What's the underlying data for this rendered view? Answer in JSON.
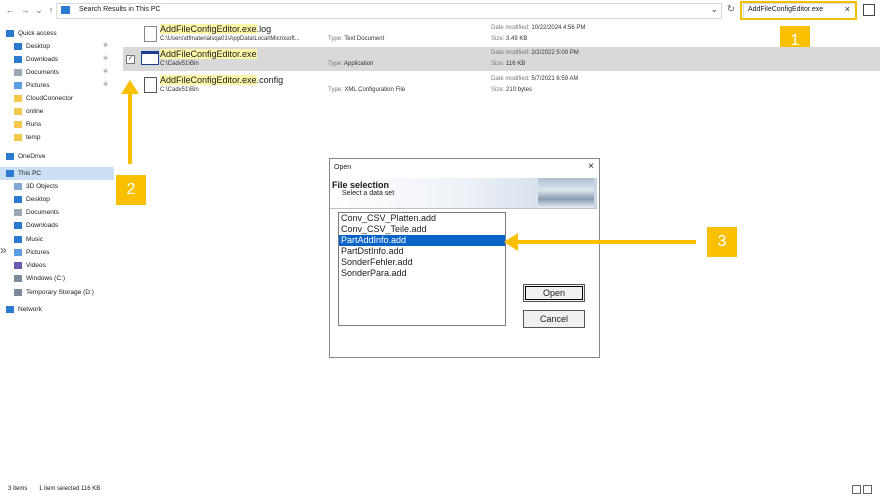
{
  "address": {
    "text": "Search Results in This PC"
  },
  "search": {
    "value": "AddFileConfigEditor.exe"
  },
  "sidebar": {
    "items": [
      {
        "label": "Quick access",
        "icon": "star-icon"
      },
      {
        "label": "Desktop",
        "icon": "desktop-icon"
      },
      {
        "label": "Downloads",
        "icon": "download-icon"
      },
      {
        "label": "Documents",
        "icon": "document-icon"
      },
      {
        "label": "Pictures",
        "icon": "picture-icon"
      },
      {
        "label": "CloudConnector",
        "icon": "folder-icon"
      },
      {
        "label": "online",
        "icon": "folder-icon"
      },
      {
        "label": "Runs",
        "icon": "folder-icon"
      },
      {
        "label": "temp",
        "icon": "folder-icon"
      },
      {
        "label": "OneDrive",
        "icon": "cloud-icon"
      },
      {
        "label": "This PC",
        "icon": "pc-icon"
      },
      {
        "label": "3D Objects",
        "icon": "cube-icon"
      },
      {
        "label": "Desktop",
        "icon": "desktop-icon"
      },
      {
        "label": "Documents",
        "icon": "document-icon"
      },
      {
        "label": "Downloads",
        "icon": "download-icon"
      },
      {
        "label": "Music",
        "icon": "music-icon"
      },
      {
        "label": "Pictures",
        "icon": "picture-icon"
      },
      {
        "label": "Videos",
        "icon": "video-icon"
      },
      {
        "label": "Windows (C:)",
        "icon": "drive-icon"
      },
      {
        "label": "Temporary Storage (D:)",
        "icon": "drive-icon"
      },
      {
        "label": "Network",
        "icon": "network-icon"
      }
    ]
  },
  "files": [
    {
      "name_hl": "AddFileConfigEditor.exe",
      "name_rest": ".log",
      "path": "C:\\Users\\dfmaterialsqa01\\AppData\\Local\\Microsoft...",
      "type_label": "Type:",
      "type": "Text Document",
      "date_label": "Date modified:",
      "date": "10/22/2024 4:56 PM",
      "size_label": "Size:",
      "size": "3.49 KB"
    },
    {
      "name_hl": "AddFileConfigEditor.exe",
      "name_rest": "",
      "path": "C:\\Cadv51\\Bin",
      "type_label": "Type:",
      "type": "Application",
      "date_label": "Date modified:",
      "date": "2/2/2022 5:00 PM",
      "size_label": "Size:",
      "size": "116 KB"
    },
    {
      "name_hl": "AddFileConfigEditor.exe",
      "name_rest": ".config",
      "path": "C:\\Cadv51\\Bin",
      "type_label": "Type:",
      "type": "XML Configuration File",
      "date_label": "Date modified:",
      "date": "5/7/2021 6:59 AM",
      "size_label": "Size:",
      "size": "210 bytes"
    }
  ],
  "dialog": {
    "title": "Open",
    "heading": "File selection",
    "subheading": "Select a data set",
    "items": [
      "Conv_CSV_Platten.add",
      "Conv_CSV_Teile.add",
      "PartAddInfo.add",
      "PartDstInfo.add",
      "SonderFehler.add",
      "SonderPara.add"
    ],
    "selected": "PartAddInfo.add",
    "open_label": "Open",
    "cancel_label": "Cancel"
  },
  "callouts": [
    "1",
    "2",
    "3"
  ],
  "status": {
    "items": "3 items",
    "selected": "1 item selected  116 KB"
  },
  "colors": {
    "callout": "#f8c000",
    "selection": "#0a64c8",
    "highlight": "#fff7a8"
  }
}
